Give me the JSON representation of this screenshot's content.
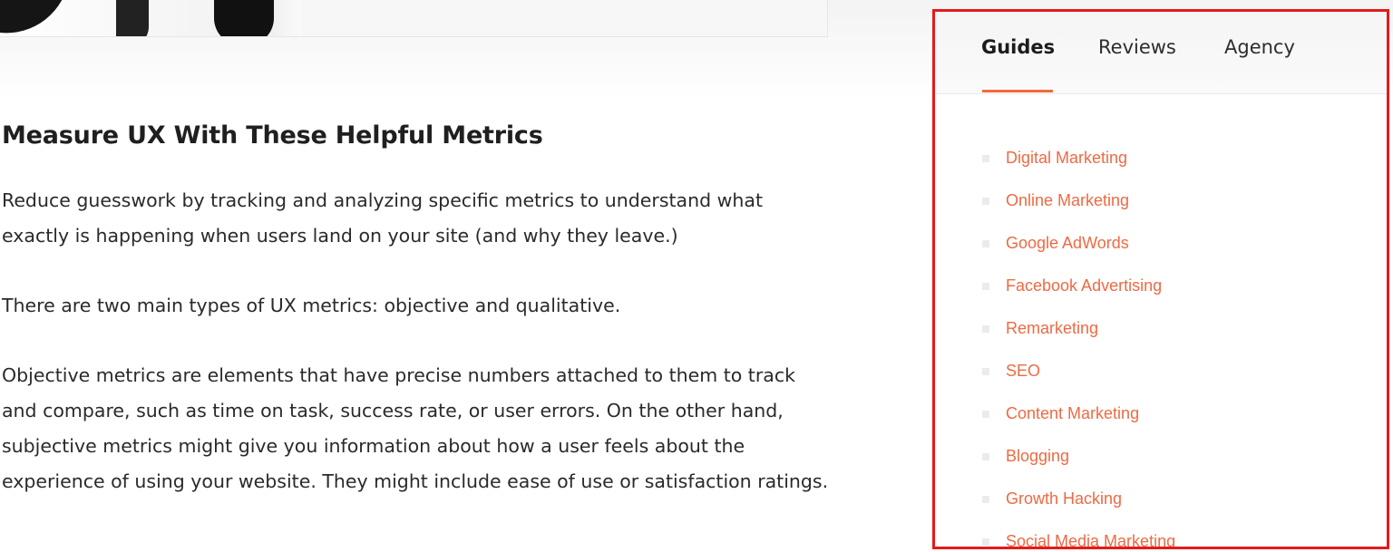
{
  "article": {
    "heading": "Measure UX With These Helpful Metrics",
    "paragraphs": [
      "Reduce guesswork by tracking and analyzing specific metrics to understand what exactly is happening when users land on your site (and why they leave.)",
      "There are two main types of UX metrics: objective and qualitative.",
      "Objective metrics are elements that have precise numbers attached to them to track and compare, such as time on task, success rate, or user errors. On the other hand, subjective metrics might give you information about how a user feels about the experience of using your website. They might include ease of use or satisfaction ratings."
    ]
  },
  "sidebar": {
    "tabs": [
      {
        "label": "Guides",
        "active": true
      },
      {
        "label": "Reviews",
        "active": false
      },
      {
        "label": "Agency",
        "active": false
      }
    ],
    "items": [
      {
        "label": "Digital Marketing"
      },
      {
        "label": "Online Marketing"
      },
      {
        "label": "Google AdWords"
      },
      {
        "label": "Facebook Advertising"
      },
      {
        "label": "Remarketing"
      },
      {
        "label": "SEO"
      },
      {
        "label": "Content Marketing"
      },
      {
        "label": "Blogging"
      },
      {
        "label": "Growth Hacking"
      },
      {
        "label": "Social Media Marketing"
      }
    ]
  },
  "colors": {
    "highlight_border": "#e31b1b",
    "link": "#ee6a43",
    "tab_underline": "#f26b3a"
  }
}
